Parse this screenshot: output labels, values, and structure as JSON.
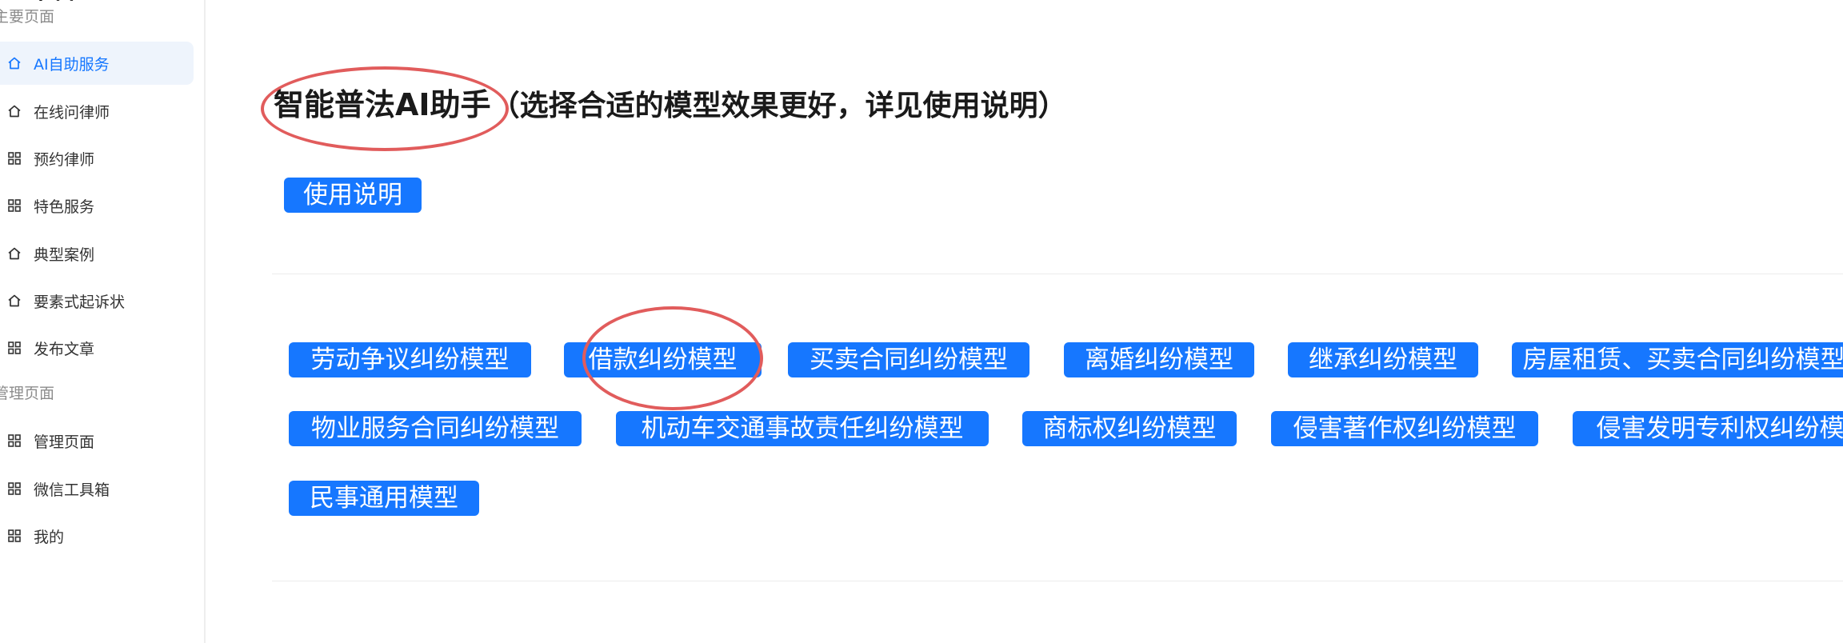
{
  "sidebar": {
    "app_title": "平台",
    "groups": [
      {
        "label": "主要页面"
      },
      {
        "label": "管理页面"
      }
    ],
    "items": [
      {
        "label": "AI自助服务",
        "icon": "home-icon",
        "active": true
      },
      {
        "label": "在线问律师",
        "icon": "home-icon"
      },
      {
        "label": "预约律师",
        "icon": "grid-icon"
      },
      {
        "label": "特色服务",
        "icon": "grid-icon"
      },
      {
        "label": "典型案例",
        "icon": "home-icon"
      },
      {
        "label": "要素式起诉状",
        "icon": "home-icon"
      },
      {
        "label": "发布文章",
        "icon": "grid-icon"
      },
      {
        "label": "管理页面",
        "icon": "grid-icon"
      },
      {
        "label": "微信工具箱",
        "icon": "grid-icon"
      },
      {
        "label": "我的",
        "icon": "grid-icon"
      }
    ]
  },
  "main": {
    "title": "智能普法AI助手",
    "title_note": "（选择合适的模型效果更好，详见使用说明）",
    "usage_button": "使用说明",
    "models": [
      "劳动争议纠纷模型",
      "借款纠纷模型",
      "买卖合同纠纷模型",
      "离婚纠纷模型",
      "继承纠纷模型",
      "房屋租赁、买卖合同纠纷模型",
      "物业服务合同纠纷模型",
      "机动车交通事故责任纠纷模型",
      "商标权纠纷模型",
      "侵害著作权纠纷模型",
      "侵害发明专利权纠纷模型",
      "民事通用模型"
    ]
  },
  "colors": {
    "accent": "#1677ff",
    "active_bg": "#eef4fc",
    "annotation": "#e15c5c"
  }
}
